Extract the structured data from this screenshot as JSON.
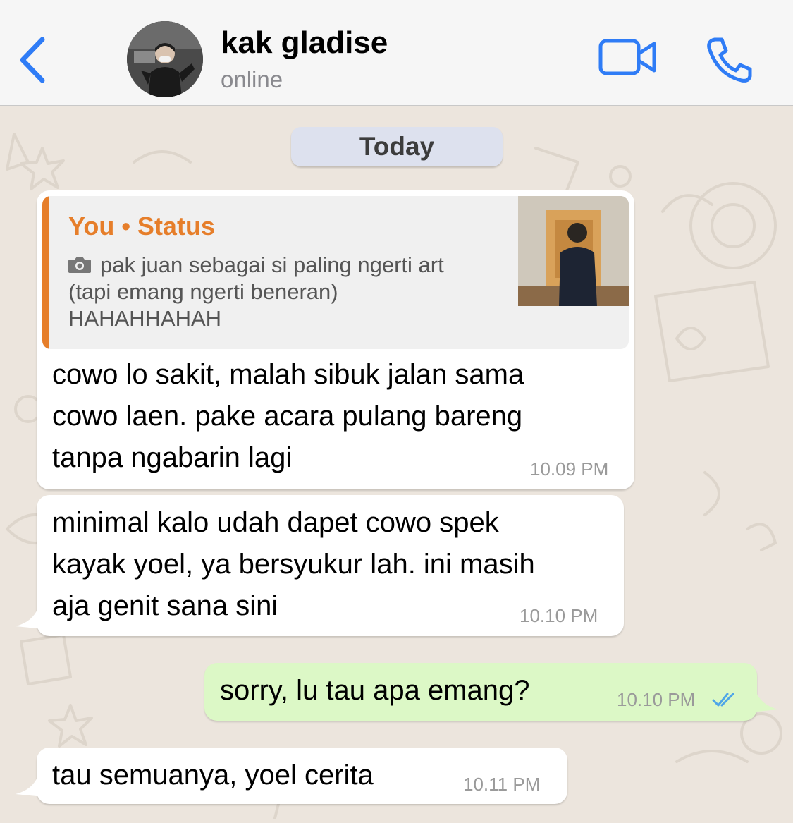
{
  "header": {
    "contact_name": "kak gladise",
    "contact_status": "online",
    "back_icon": "chevron-left-icon",
    "video_icon": "video-camera-icon",
    "call_icon": "phone-icon",
    "accent_color": "#2f7cf6"
  },
  "chat": {
    "date_label": "Today",
    "messages": [
      {
        "direction": "incoming",
        "quote": {
          "author": "You • Status",
          "lines": [
            "pak juan sebagai si paling ngerti art",
            "(tapi emang ngerti beneran)",
            "HAHAHHAHAH"
          ],
          "icon": "camera-icon"
        },
        "lines": [
          "cowo lo sakit, malah sibuk jalan sama",
          "cowo laen. pake acara pulang bareng",
          "tanpa ngabarin lagi"
        ],
        "time": "10.09 PM"
      },
      {
        "direction": "incoming",
        "lines": [
          "minimal kalo udah dapet cowo spek",
          "kayak yoel, ya bersyukur lah. ini masih",
          "aja genit sana sini"
        ],
        "time": "10.10 PM"
      },
      {
        "direction": "outgoing",
        "lines": [
          "sorry, lu tau apa emang?"
        ],
        "time": "10.10 PM",
        "read_icon": "double-check-icon",
        "read_color": "#4fa6e8"
      },
      {
        "direction": "incoming",
        "lines": [
          "tau semuanya, yoel cerita"
        ],
        "time": "10.11 PM"
      }
    ]
  }
}
